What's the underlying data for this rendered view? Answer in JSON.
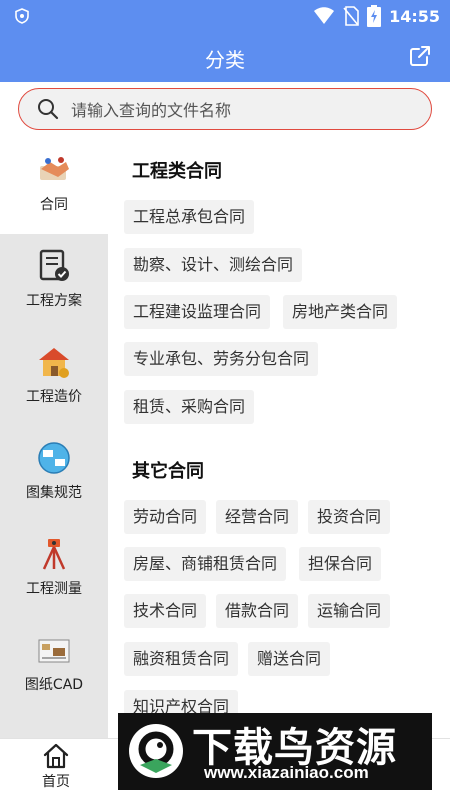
{
  "status_bar": {
    "time": "14:55"
  },
  "header": {
    "title": "分类"
  },
  "search": {
    "placeholder": "请输入查询的文件名称"
  },
  "sidebar": {
    "items": [
      {
        "label": "合同",
        "active": true
      },
      {
        "label": "工程方案",
        "active": false
      },
      {
        "label": "工程造价",
        "active": false
      },
      {
        "label": "图集规范",
        "active": false
      },
      {
        "label": "工程测量",
        "active": false
      },
      {
        "label": "图纸CAD",
        "active": false
      }
    ]
  },
  "sections": [
    {
      "title": "工程类合同",
      "chips": [
        "工程总承包合同",
        "勘察、设计、测绘合同",
        "工程建设监理合同",
        "房地产类合同",
        "专业承包、劳务分包合同",
        "租赁、采购合同"
      ]
    },
    {
      "title": "其它合同",
      "chips": [
        "劳动合同",
        "经营合同",
        "投资合同",
        "房屋、商铺租赁合同",
        "担保合同",
        "技术合同",
        "借款合同",
        "运输合同",
        "融资租赁合同",
        "赠送合同",
        "知识产权合同"
      ]
    }
  ],
  "tabbar": {
    "home_label": "首页"
  },
  "watermark": {
    "title": "下载鸟资源",
    "url": "www.xiazainiao.com"
  },
  "colors": {
    "primary": "#5d8ef0",
    "search_border": "#e04a3f",
    "sidebar_bg": "#e6e6e6",
    "chip_bg": "#f2f2f2"
  }
}
